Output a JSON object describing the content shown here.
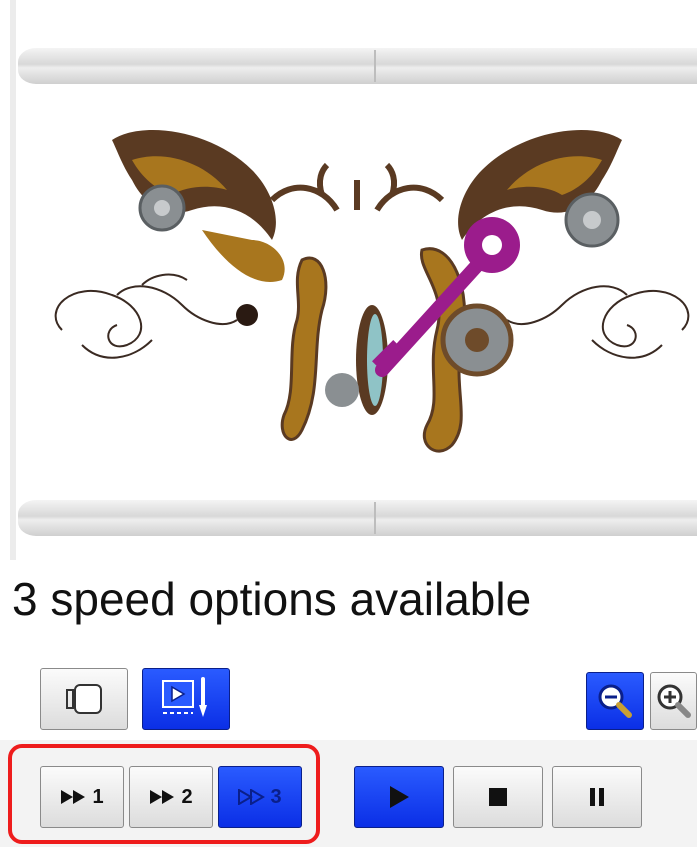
{
  "caption": "3 speed options available",
  "toolbar": {
    "mode_buttons": [
      {
        "name": "hoop-view-button",
        "icon": "frame-icon",
        "active": false
      },
      {
        "name": "sewing-simulation-button",
        "icon": "needle-simulation-icon",
        "active": true
      }
    ],
    "zoom_buttons": [
      {
        "name": "zoom-out-button",
        "icon": "magnifier-minus-icon",
        "active": true
      },
      {
        "name": "zoom-in-button",
        "icon": "magnifier-plus-icon",
        "active": false
      }
    ]
  },
  "speed": {
    "options": [
      {
        "label": "1",
        "icon": "fast-forward-icon",
        "active": false
      },
      {
        "label": "2",
        "icon": "fast-forward-icon",
        "active": false
      },
      {
        "label": "3",
        "icon": "fast-forward-icon",
        "active": true
      }
    ],
    "selected": "3"
  },
  "playback": {
    "buttons": [
      {
        "name": "play-button",
        "icon": "play-icon",
        "active": true
      },
      {
        "name": "stop-button",
        "icon": "stop-icon",
        "active": false
      },
      {
        "name": "pause-button",
        "icon": "pause-icon",
        "active": false
      }
    ]
  },
  "colors": {
    "active_blue": "#0b2fe6",
    "highlight_red": "#ee1c1c",
    "thread_brown": "#5a3a22",
    "thread_gold": "#a8761e",
    "thread_magenta": "#9b1c8c",
    "thread_gray": "#8a8f92"
  }
}
